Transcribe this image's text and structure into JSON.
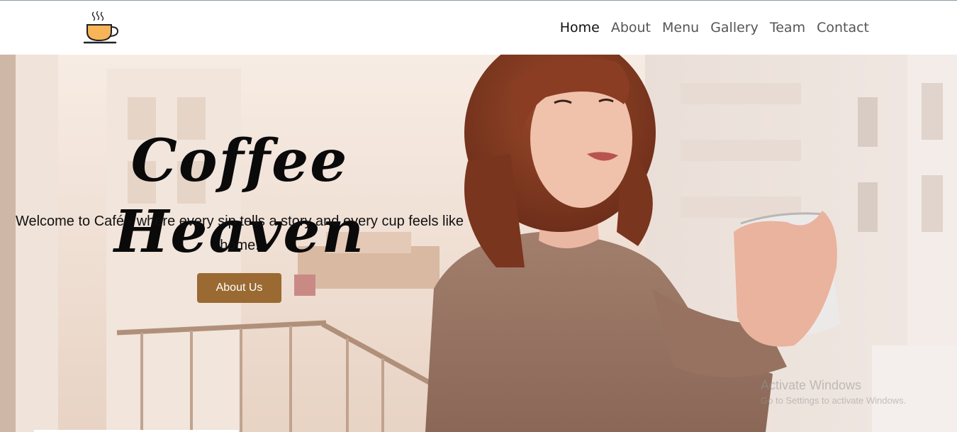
{
  "nav": {
    "logo_icon": "coffee-cup-icon",
    "items": [
      {
        "label": "Home",
        "active": true
      },
      {
        "label": "About"
      },
      {
        "label": "Menu"
      },
      {
        "label": "Gallery"
      },
      {
        "label": "Team"
      },
      {
        "label": "Contact"
      }
    ]
  },
  "hero": {
    "title": "Coffee Heaven",
    "text": "Welcome to Café - where every sip tells a story and every cup feels like home.",
    "button_label": "About Us",
    "button_color": "#9a6a32"
  },
  "watermark": {
    "title": "Activate Windows",
    "subtitle": "Go to Settings to activate Windows."
  }
}
